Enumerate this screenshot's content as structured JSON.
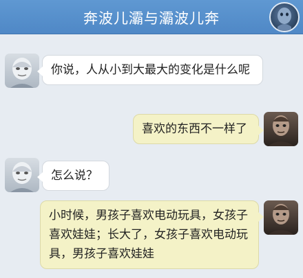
{
  "header": {
    "title": "奔波儿灞与灞波儿奔",
    "avatar_icon": "profile-avatar-icon"
  },
  "colors": {
    "header_bg": "#5591cc",
    "chat_bg": "#e7ecf2",
    "incoming_bubble": "#ffffff",
    "outgoing_bubble": "#f4f2c7"
  },
  "messages": [
    {
      "side": "left",
      "text": "你说，人从小到大最大的变化是什么呢"
    },
    {
      "side": "right",
      "text": "喜欢的东西不一样了"
    },
    {
      "side": "left",
      "text": "怎么说？"
    },
    {
      "side": "right",
      "text": "小时候，男孩子喜欢电动玩具，女孩子喜欢娃娃；长大了，女孩子喜欢电动玩具，男孩子喜欢娃娃"
    }
  ]
}
